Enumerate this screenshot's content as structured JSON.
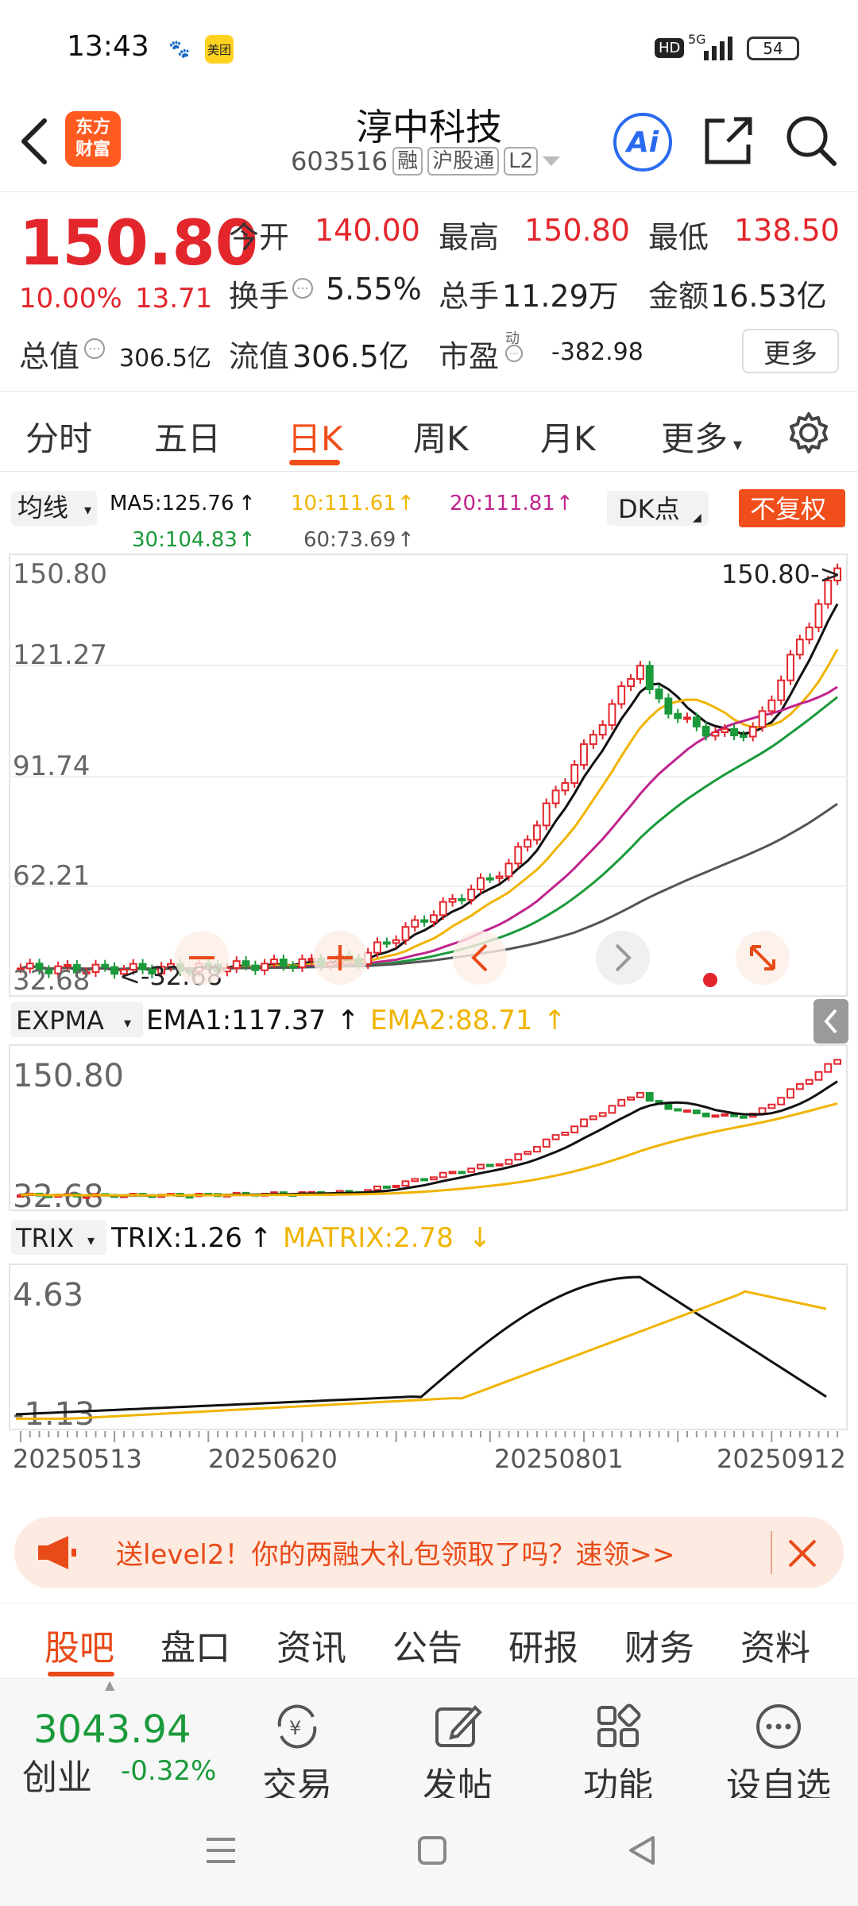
{
  "status_bar": {
    "time": "13:43",
    "network": "5G",
    "hd": "HD",
    "battery": "54",
    "app_icon_1": "百度",
    "app_icon_2": "美团"
  },
  "header": {
    "back_icon": "chevron-left-icon",
    "logo_text": "东方\n财富",
    "stock_name": "淳中科技",
    "stock_code": "603516",
    "tags": [
      "融",
      "沪股通",
      "L2"
    ],
    "ai_label": "Ai"
  },
  "quote": {
    "price": "150.80",
    "change_pct": "10.00%",
    "change": "13.71",
    "open_label": "今开",
    "open": "140.00",
    "high_label": "最高",
    "high": "150.80",
    "low_label": "最低",
    "low": "138.50",
    "turnover_label": "换手",
    "turnover": "5.55%",
    "volume_label": "总手",
    "volume": "11.29万",
    "amount_label": "金额",
    "amount": "16.53亿",
    "total_cap_label": "总值",
    "total_cap": "306.5亿",
    "float_cap_label": "流值",
    "float_cap": "306.5亿",
    "pe_label": "市盈",
    "pe_sup": "动",
    "pe": "-382.98",
    "more_label": "更多"
  },
  "ktabs": [
    "分时",
    "五日",
    "日K",
    "周K",
    "月K",
    "更多"
  ],
  "ktab_active": "日K",
  "chart": {
    "indicator_select": "均线",
    "ma5": "MA5:125.76",
    "ma10": "10:111.61",
    "ma20": "20:111.81",
    "ma30": "30:104.83",
    "ma60": "60:73.69",
    "dk_label": "DK点",
    "fuquan_label": "不复权",
    "y_ticks": [
      "150.80",
      "121.27",
      "91.74",
      "62.21",
      "32.68"
    ],
    "max_label": "150.80->",
    "min_label": "<-32.68",
    "expma_select": "EXPMA",
    "ema1": "EMA1:117.37",
    "ema2": "EMA2:88.71",
    "expma_top": "150.80",
    "expma_bottom": "32.68",
    "trix_select": "TRIX",
    "trix": "TRIX:1.26",
    "matrix": "MATRIX:2.78",
    "trix_top": "4.63",
    "trix_bottom": "-1.13",
    "dates": [
      "20250513",
      "20250620",
      "20250801",
      "20250912"
    ],
    "colors": {
      "up": "#e2262c",
      "down": "#1a9a3a",
      "ma5": "#111111",
      "ma10": "#f0b400",
      "ma20": "#c0248e",
      "ma30": "#1a9a3a",
      "ma60": "#555555"
    }
  },
  "banner": {
    "text": "送level2！你的两融大礼包领取了吗？速领>>"
  },
  "btabs": [
    "股吧",
    "盘口",
    "资讯",
    "公告",
    "研报",
    "财务",
    "资料"
  ],
  "btab_active": "股吧",
  "index": {
    "value": "3043.94",
    "name": "创业",
    "change": "-0.32%"
  },
  "nav": [
    {
      "label": "交易",
      "icon": "yen-cycle-icon"
    },
    {
      "label": "发帖",
      "icon": "edit-icon"
    },
    {
      "label": "功能",
      "icon": "grid-icon"
    },
    {
      "label": "设自选",
      "icon": "more-dots-icon"
    }
  ]
}
